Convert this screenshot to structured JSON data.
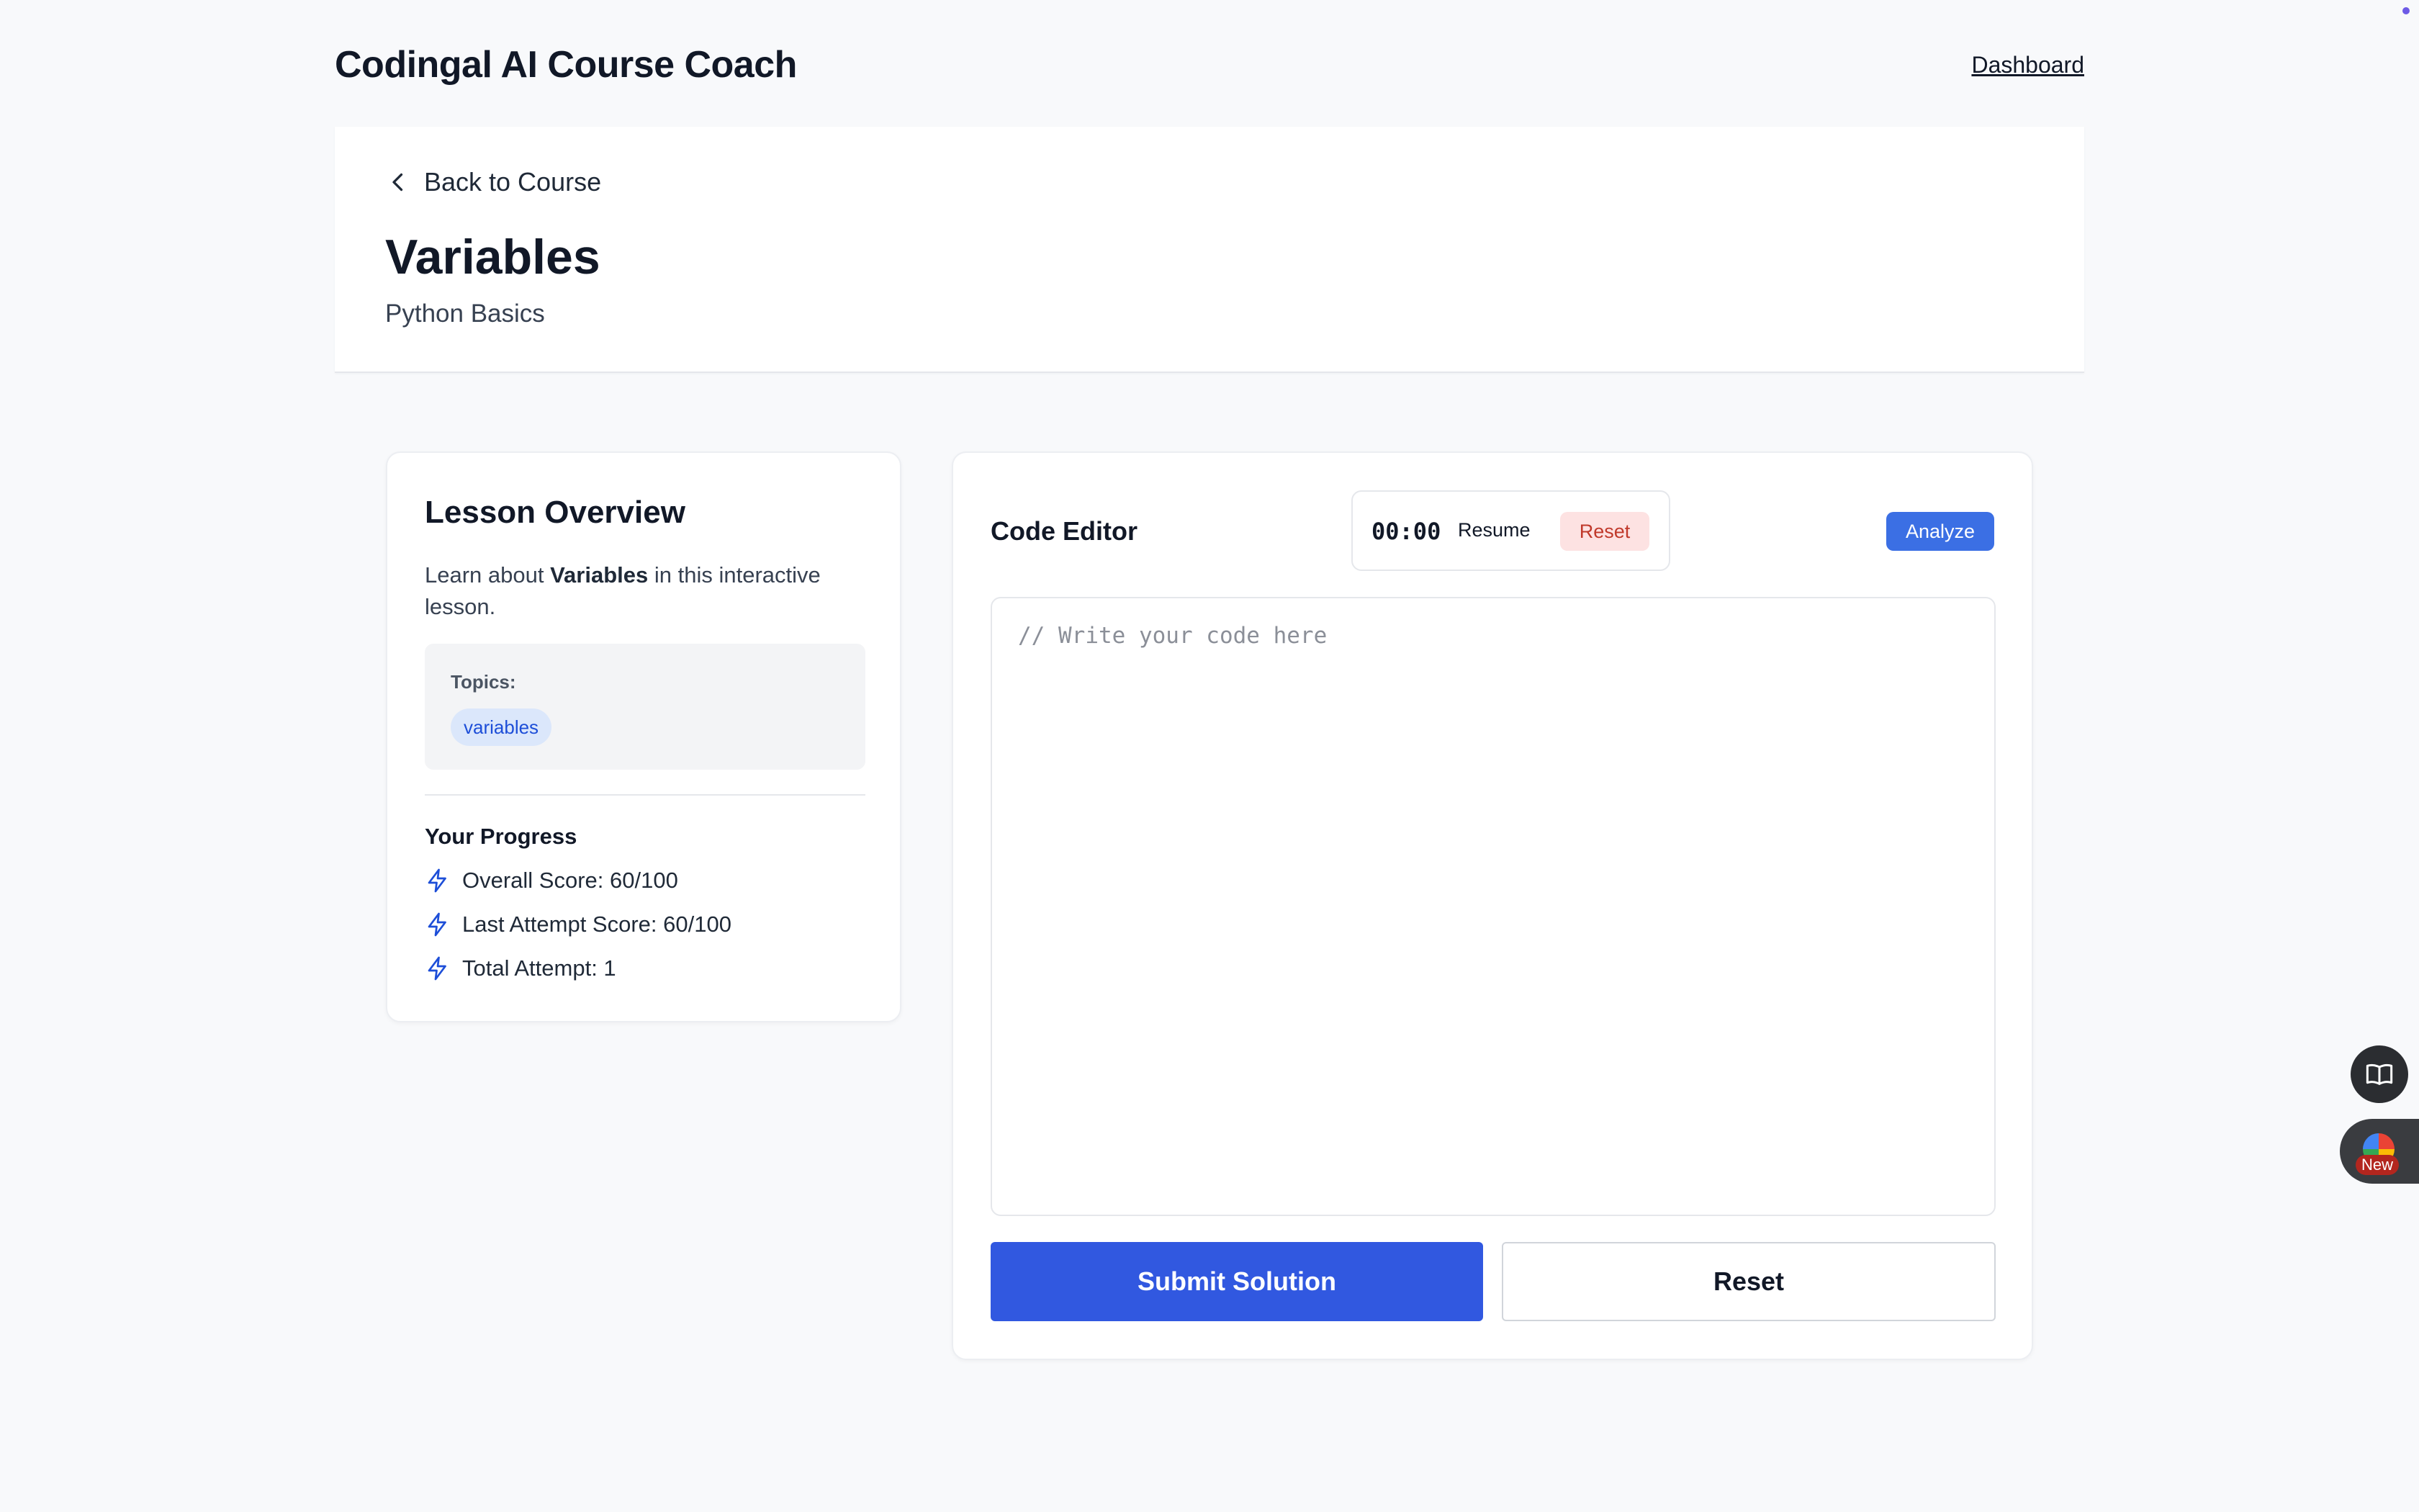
{
  "header": {
    "app_title": "Codingal AI Course Coach",
    "dashboard_link": "Dashboard"
  },
  "lesson": {
    "back_label": "Back to Course",
    "title": "Variables",
    "course": "Python Basics"
  },
  "overview": {
    "title": "Lesson Overview",
    "desc_prefix": "Learn about ",
    "desc_topic": "Variables",
    "desc_suffix": " in this interactive lesson.",
    "topics_label": "Topics:",
    "topics": [
      "variables"
    ],
    "progress_title": "Your Progress",
    "stats": [
      {
        "label": "Overall Score: 60/100",
        "icon": "lightning-icon"
      },
      {
        "label": "Last Attempt Score: 60/100",
        "icon": "lightning-icon"
      },
      {
        "label": "Total Attempt: 1",
        "icon": "lightning-icon"
      }
    ]
  },
  "editor": {
    "title": "Code Editor",
    "timer": "00:00",
    "resume_label": "Resume",
    "timer_reset_label": "Reset",
    "analyze_label": "Analyze",
    "placeholder": "// Write your code here",
    "submit_label": "Submit Solution",
    "reset_label": "Reset"
  },
  "floating": {
    "new_badge": "New"
  },
  "colors": {
    "primary": "#3158e0",
    "analyze": "#3b6fe4",
    "reset_bg": "#fde2e2",
    "chip_bg": "#dbe7fb",
    "icon_blue": "#1d4ed8"
  }
}
